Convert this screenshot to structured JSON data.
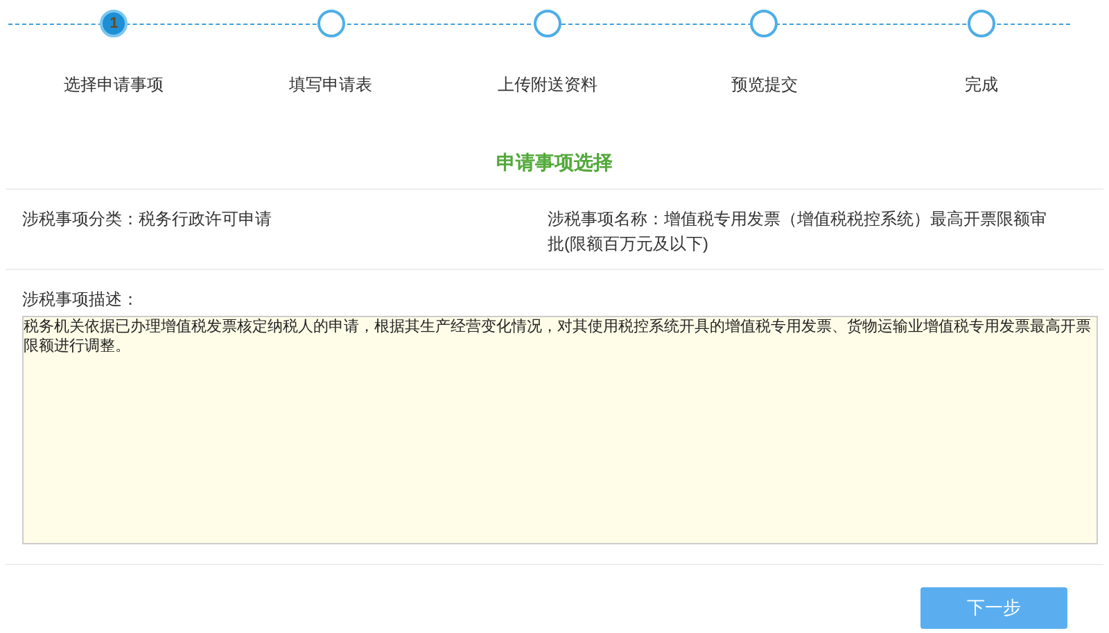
{
  "steps": [
    {
      "number": "1",
      "label": "选择申请事项",
      "selected": true
    },
    {
      "label": "填写申请表",
      "selected": false
    },
    {
      "label": "上传附送资料",
      "selected": false
    },
    {
      "label": "预览提交",
      "selected": false
    },
    {
      "label": "完成",
      "selected": false
    }
  ],
  "section_title": "申请事项选择",
  "category": "涉税事项分类：税务行政许可申请",
  "item_name": "涉税事项名称：增值税专用发票（增值税税控系统）最高开票限额审批(限额百万元及以下)",
  "description_label": "涉税事项描述：",
  "description": "税务机关依据已办理增值税发票核定纳税人的申请，根据其生产经营变化情况，对其使用税控系统开具的增值税专用发票、货物运输业增值税专用发票最高开票限额进行调整。",
  "next_button": "下一步"
}
